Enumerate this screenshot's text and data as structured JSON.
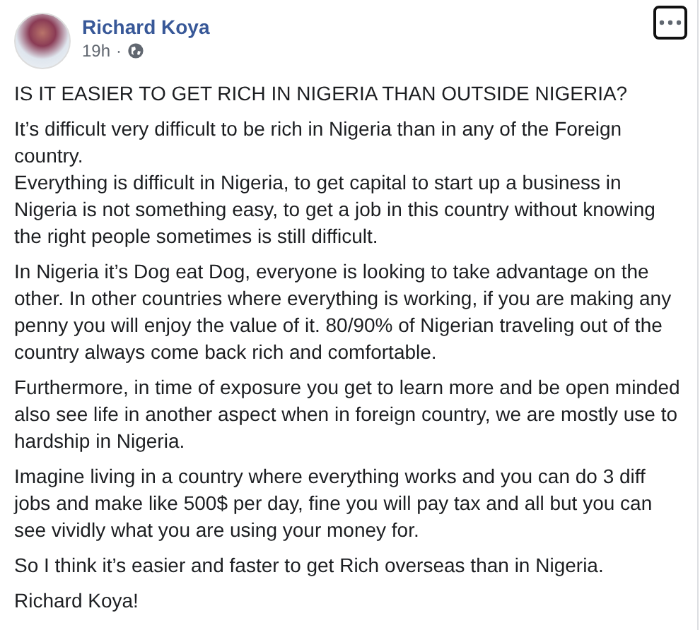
{
  "post": {
    "author": "Richard Koya",
    "time": "19h",
    "separator": "·",
    "paragraphs": [
      {
        "lines": [
          "IS IT EASIER TO GET RICH IN NIGERIA THAN OUTSIDE NIGERIA?"
        ]
      },
      {
        "lines": [
          "It’s difficult very difficult to be rich in Nigeria than in any of the Foreign country.",
          "Everything is difficult in Nigeria, to get capital to start up a business in Nigeria is not something easy, to get a job in this country without knowing the right people sometimes is still difficult."
        ]
      },
      {
        "lines": [
          "In Nigeria it’s Dog eat Dog, everyone is looking to take advantage on the other. In other countries where everything is working, if you are making any penny you will enjoy the value of it. 80/90% of Nigerian traveling out of the country always come back rich and comfortable."
        ]
      },
      {
        "lines": [
          "Furthermore, in time of exposure you get to learn more and be open minded also see life in another aspect when in foreign country, we are mostly use to hardship in Nigeria."
        ]
      },
      {
        "lines": [
          "Imagine living in a country where everything works and you can do 3 diff jobs and make like 500$ per day, fine you will pay tax and all but you can see vividly what you are using your money for."
        ]
      },
      {
        "lines": [
          "So I think it’s easier and faster to get Rich overseas than in Nigeria."
        ]
      },
      {
        "lines": [
          "Richard Koya!"
        ]
      }
    ]
  }
}
